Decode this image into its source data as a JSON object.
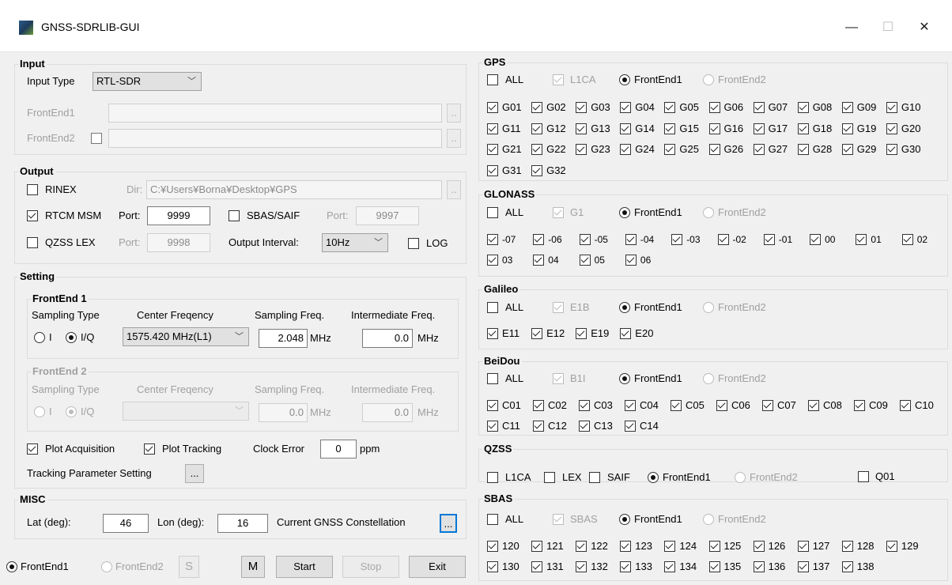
{
  "window": {
    "title": "GNSS-SDRLIB-GUI",
    "min": "—",
    "max": "☐",
    "close": "✕"
  },
  "input": {
    "title": "Input",
    "type_label": "Input Type",
    "type_value": "RTL-SDR",
    "fe1_label": "FrontEnd1",
    "fe2_label": "FrontEnd2",
    "browse": ".."
  },
  "output": {
    "title": "Output",
    "rinex": "RINEX",
    "dir_label": "Dir:",
    "dir_value": "C:¥Users¥Borna¥Desktop¥GPS",
    "rtcm": "RTCM MSM",
    "port_label": "Port:",
    "rtcm_port": "9999",
    "sbas": "SBAS/SAIF",
    "sbas_port": "9997",
    "qzss": "QZSS LEX",
    "qzss_port": "9998",
    "interval_label": "Output Interval:",
    "interval_value": "10Hz",
    "log": "LOG"
  },
  "setting": {
    "title": "Setting",
    "fe1_title": "FrontEnd 1",
    "fe2_title": "FrontEnd 2",
    "samp_type": "Sampling Type",
    "center": "Center Freqency",
    "samp_freq": "Sampling Freq.",
    "if_freq": "Intermediate Freq.",
    "opt_i": "I",
    "opt_iq": "I/Q",
    "center_value": "1575.420 MHz(L1)",
    "samp_value": "2.048",
    "mhz": "MHz",
    "if_value": "0.0",
    "fe2_samp_value": "0.0",
    "fe2_if_value": "0.0",
    "plot_acq": "Plot Acquisition",
    "plot_trk": "Plot Tracking",
    "clock_label": "Clock Error",
    "clock_value": "0",
    "ppm": "ppm",
    "tracking_param": "Tracking Parameter Setting",
    "dots": "..."
  },
  "misc": {
    "title": "MISC",
    "lat_label": "Lat (deg):",
    "lat_value": "46",
    "lon_label": "Lon (deg):",
    "lon_value": "16",
    "constellation": "Current GNSS Constellation",
    "dots": "..."
  },
  "bottom": {
    "fe1": "FrontEnd1",
    "fe2": "FrontEnd2",
    "s": "S",
    "m": "M",
    "start": "Start",
    "stop": "Stop",
    "exit": "Exit"
  },
  "gps": {
    "title": "GPS",
    "all": "ALL",
    "signal": "L1CA",
    "fe1": "FrontEnd1",
    "fe2": "FrontEnd2",
    "sats": [
      "G01",
      "G02",
      "G03",
      "G04",
      "G05",
      "G06",
      "G07",
      "G08",
      "G09",
      "G10",
      "G11",
      "G12",
      "G13",
      "G14",
      "G15",
      "G16",
      "G17",
      "G18",
      "G19",
      "G20",
      "G21",
      "G22",
      "G23",
      "G24",
      "G25",
      "G26",
      "G27",
      "G28",
      "G29",
      "G30",
      "G31",
      "G32"
    ]
  },
  "glonass": {
    "title": "GLONASS",
    "all": "ALL",
    "signal": "G1",
    "fe1": "FrontEnd1",
    "fe2": "FrontEnd2",
    "sats": [
      "-07",
      "-06",
      "-05",
      "-04",
      "-03",
      "-02",
      "-01",
      "00",
      "01",
      "02",
      "03",
      "04",
      "05",
      "06"
    ]
  },
  "galileo": {
    "title": "Galileo",
    "all": "ALL",
    "signal": "E1B",
    "fe1": "FrontEnd1",
    "fe2": "FrontEnd2",
    "sats": [
      "E11",
      "E12",
      "E19",
      "E20"
    ]
  },
  "beidou": {
    "title": "BeiDou",
    "all": "ALL",
    "signal": "B1I",
    "fe1": "FrontEnd1",
    "fe2": "FrontEnd2",
    "sats": [
      "C01",
      "C02",
      "C03",
      "C04",
      "C05",
      "C06",
      "C07",
      "C08",
      "C09",
      "C10",
      "C11",
      "C12",
      "C13",
      "C14"
    ]
  },
  "qzss": {
    "title": "QZSS",
    "l1ca": "L1CA",
    "lex": "LEX",
    "saif": "SAIF",
    "fe1": "FrontEnd1",
    "fe2": "FrontEnd2",
    "sat": "Q01"
  },
  "sbas": {
    "title": "SBAS",
    "all": "ALL",
    "signal": "SBAS",
    "fe1": "FrontEnd1",
    "fe2": "FrontEnd2",
    "sats": [
      "120",
      "121",
      "122",
      "123",
      "124",
      "125",
      "126",
      "127",
      "128",
      "129",
      "130",
      "131",
      "132",
      "133",
      "134",
      "135",
      "136",
      "137",
      "138"
    ]
  }
}
